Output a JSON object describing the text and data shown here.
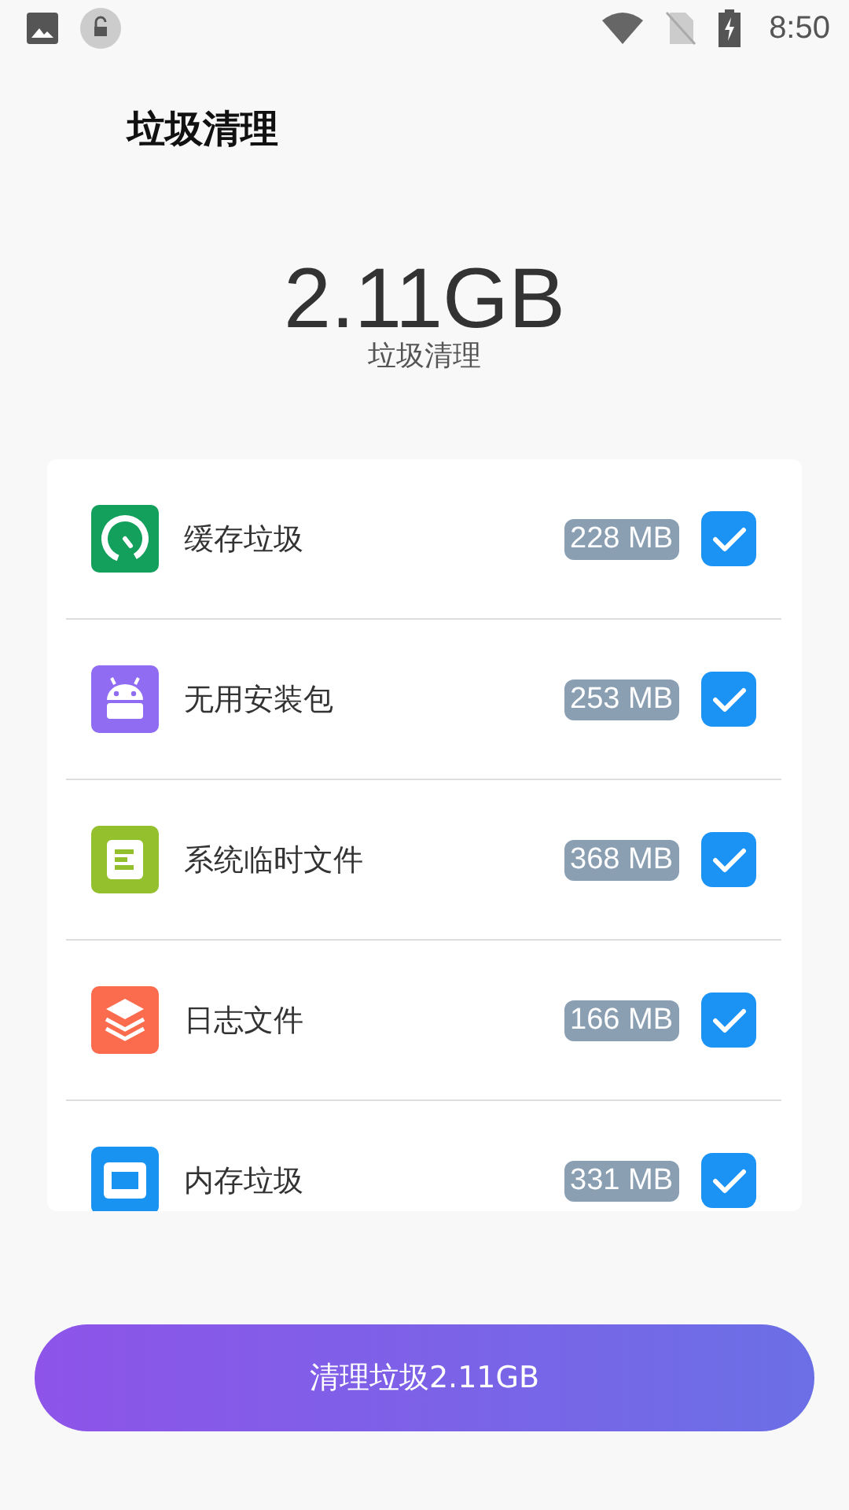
{
  "status_bar": {
    "time": "8:50"
  },
  "title": "垃圾清理",
  "summary": {
    "size": "2.11GB",
    "label": "垃圾清理"
  },
  "items": [
    {
      "kind": "cache",
      "label": "缓存垃圾",
      "size": "228 MB",
      "checked": true
    },
    {
      "kind": "apk",
      "label": "无用安装包",
      "size": "253 MB",
      "checked": true
    },
    {
      "kind": "temp",
      "label": "系统临时文件",
      "size": "368 MB",
      "checked": true
    },
    {
      "kind": "log",
      "label": "日志文件",
      "size": "166 MB",
      "checked": true
    },
    {
      "kind": "memory",
      "label": "内存垃圾",
      "size": "331 MB",
      "checked": true
    }
  ],
  "clean_button": "清理垃圾2.11GB"
}
